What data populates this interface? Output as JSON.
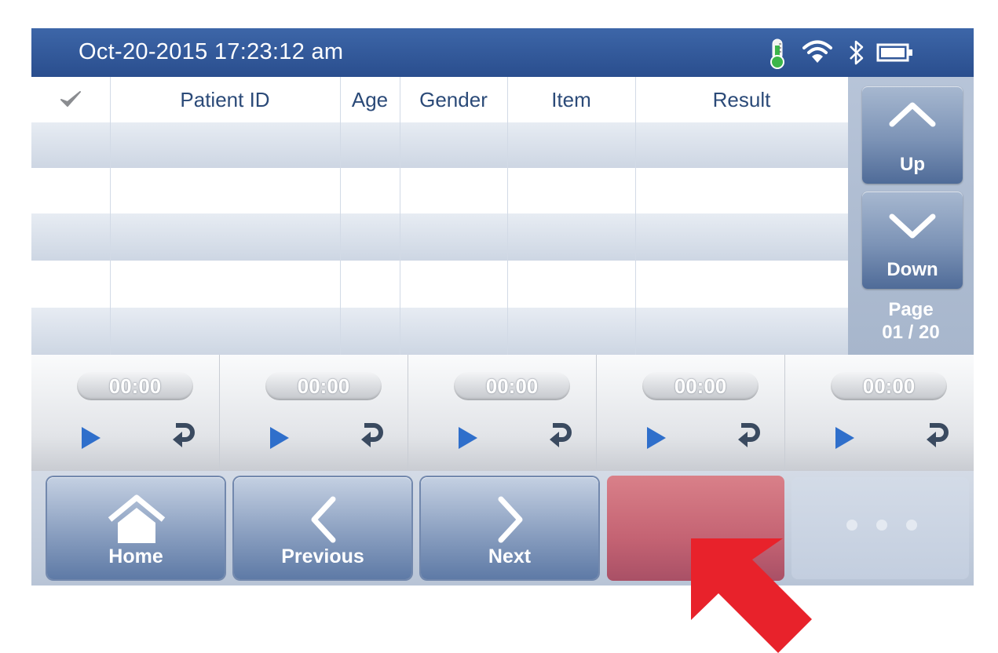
{
  "status_bar": {
    "datetime": "Oct-20-2015  17:23:12 am",
    "icons": [
      "thermometer-icon",
      "wifi-icon",
      "bluetooth-icon",
      "battery-icon"
    ]
  },
  "table": {
    "columns": [
      "Patient ID",
      "Age",
      "Gender",
      "Item",
      "Result"
    ],
    "checkbox_icon": "checkmark-icon",
    "rows": []
  },
  "side_panel": {
    "up_label": "Up",
    "down_label": "Down",
    "page_label": "Page",
    "page_value": "01 / 20"
  },
  "timers": [
    {
      "time": "00:00"
    },
    {
      "time": "00:00"
    },
    {
      "time": "00:00"
    },
    {
      "time": "00:00"
    },
    {
      "time": "00:00"
    }
  ],
  "nav": {
    "home_label": "Home",
    "previous_label": "Previous",
    "next_label": "Next"
  },
  "colors": {
    "status_bar": "#2f548f",
    "header_text": "#2b4a78",
    "stop_button": "#c46373",
    "play_icon": "#2f6fcb",
    "pointer_arrow": "#e8222b"
  }
}
